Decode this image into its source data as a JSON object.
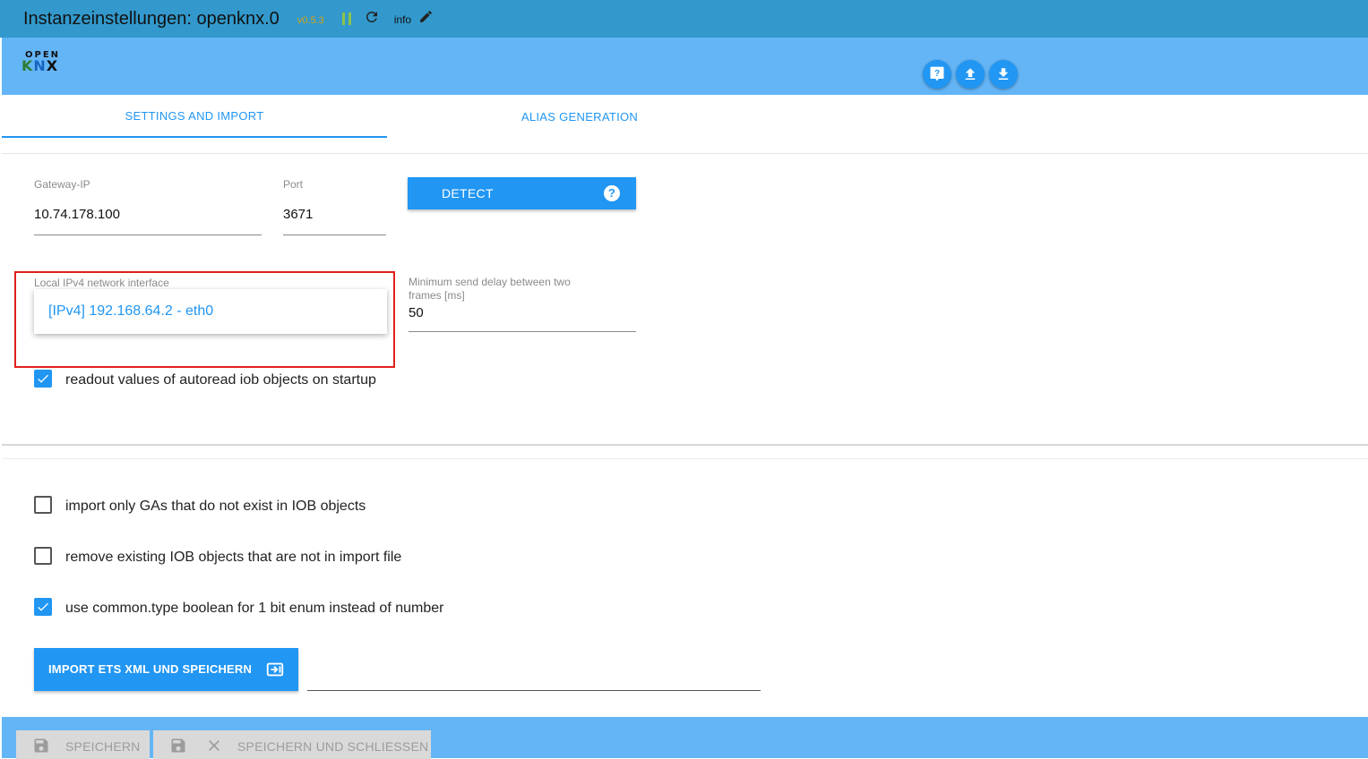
{
  "window": {
    "title": "Instanzeinstellungen: openknx.0",
    "version": "v0.5.3",
    "info_label": "info",
    "icons": [
      "pause-icon",
      "reload-icon",
      "edit-icon"
    ]
  },
  "logo": {
    "top": "OPEN",
    "bottom_k": "K",
    "bottom_n": "N",
    "bottom_x": "X"
  },
  "header_actions": [
    {
      "name": "help-button",
      "icon": "help-chat-icon"
    },
    {
      "name": "upload-button",
      "icon": "upload-icon"
    },
    {
      "name": "download-button",
      "icon": "download-icon"
    }
  ],
  "tabs": [
    {
      "label": "SETTINGS AND IMPORT",
      "active": true
    },
    {
      "label": "ALIAS GENERATION",
      "active": false
    }
  ],
  "settings": {
    "gateway_ip": {
      "label": "Gateway-IP",
      "value": "10.74.178.100"
    },
    "port": {
      "label": "Port",
      "value": "3671"
    },
    "detect_button": {
      "label": "DETECT",
      "icon": "help-circle-icon"
    },
    "local_interface": {
      "label": "Local IPv4 network interface",
      "selected": "[IPv4] 192.168.64.2 - eth0"
    },
    "min_delay": {
      "label_line1": "Minimum send delay between two",
      "label_line2": "frames [ms]",
      "value": "50"
    },
    "autoread": {
      "label": "readout values of autoread iob objects on startup",
      "checked": true
    }
  },
  "import": {
    "only_new": {
      "label": "import only GAs that do not exist in IOB objects",
      "checked": false
    },
    "remove_existing": {
      "label": "remove existing IOB objects that are not in import file",
      "checked": false
    },
    "boolean_enum": {
      "label": "use common.type boolean for 1 bit enum instead of number",
      "checked": true
    },
    "button_label": "IMPORT ETS XML UND SPEICHERN",
    "button_icon": "import-icon"
  },
  "footer": {
    "save_label": "SPEICHERN",
    "save_close_label": "SPEICHERN UND SCHLIESSEN",
    "icons": [
      "save-icon",
      "close-icon"
    ]
  },
  "colors": {
    "titlebar": "#3399cc",
    "appbar": "#64b5f6",
    "accent": "#2196f3",
    "version": "#d4a017",
    "highlight_box": "#e0201b"
  }
}
